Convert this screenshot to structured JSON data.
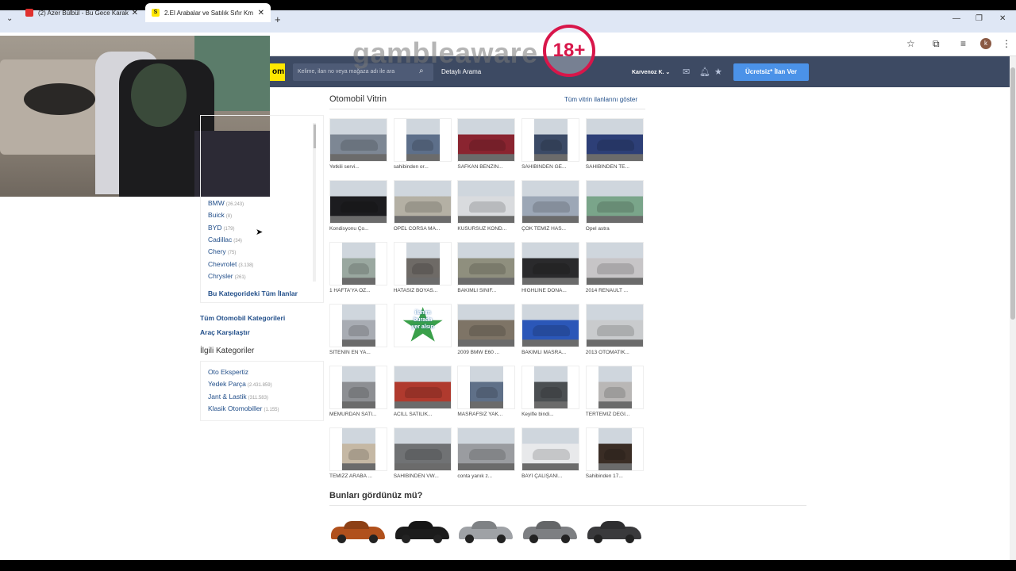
{
  "browser": {
    "tabs": [
      {
        "title": "(2) Azer Bülbül - Bu Gece Karak",
        "favicon_color": "#e0312f"
      },
      {
        "title": "2.El Arabalar ve Satılık Sıfır Km",
        "favicon_color": "#ffe800"
      }
    ],
    "new_tab": "+",
    "avatar_letter": "k"
  },
  "overlay": {
    "gamble_text": "gambleaware",
    "age_badge": "18+"
  },
  "header": {
    "logo": "om",
    "search_placeholder": "Kelime, ilan no veya mağaza adı ile ara",
    "detailed_search": "Detaylı Arama",
    "user": "Karvenoz K.",
    "post_ad": "Ücretsiz* İlan Ver"
  },
  "sidebar": {
    "brands": [
      {
        "name": "BMW",
        "count": "(26.243)"
      },
      {
        "name": "Buick",
        "count": "(8)"
      },
      {
        "name": "BYD",
        "count": "(179)"
      },
      {
        "name": "Cadillac",
        "count": "(34)"
      },
      {
        "name": "Chery",
        "count": "(75)"
      },
      {
        "name": "Chevrolet",
        "count": "(3.138)"
      },
      {
        "name": "Chrysler",
        "count": "(261)"
      }
    ],
    "all_ads": "Bu Kategorideki Tüm İlanlar",
    "links": [
      "Tüm Otomobil Kategorileri",
      "Araç Karşılaştır"
    ],
    "related_title": "İlgili Kategoriler",
    "related": [
      {
        "name": "Oto Ekspertiz",
        "count": ""
      },
      {
        "name": "Yedek Parça",
        "count": "(2.431.859)"
      },
      {
        "name": "Jant & Lastik",
        "count": "(311.583)"
      },
      {
        "name": "Klasik Otomobiller",
        "count": "(1.155)"
      }
    ]
  },
  "vitrin": {
    "title": "Otomobil Vitrin",
    "show_all": "Tüm vitrin ilanlarını göster",
    "items": [
      {
        "caption": "Yetkili servi...",
        "color": "#7d8794"
      },
      {
        "caption": "sahibinden or...",
        "color": "#5d6f8a"
      },
      {
        "caption": "SAFKAN BENZİN...",
        "color": "#8a2430"
      },
      {
        "caption": "SAHİBİNDEN GE...",
        "color": "#3b4a66"
      },
      {
        "caption": "SAHİBİNDEN TE...",
        "color": "#2d3f77"
      },
      {
        "caption": "Kondisyonu Ço...",
        "color": "#1c1c1f"
      },
      {
        "caption": "OPEL CORSA MA...",
        "color": "#b4b0a4"
      },
      {
        "caption": "KUSURSUZ KOND...",
        "color": "#d9dbde"
      },
      {
        "caption": "ÇOK TEMİZ HAS...",
        "color": "#9ca7b6"
      },
      {
        "caption": "Opel astra",
        "color": "#7aa58a"
      },
      {
        "caption": "1 HAFTA'YA ÖZ...",
        "color": "#9aa8a0"
      },
      {
        "caption": "HATASIZ BOYAS...",
        "color": "#6e6a66"
      },
      {
        "caption": "BAKIMLI SINIF...",
        "color": "#8f8f7e"
      },
      {
        "caption": "HİGHLİNE DONA...",
        "color": "#2a2a2c"
      },
      {
        "caption": "2014 RENAULT ...",
        "color": "#c7c5c7"
      },
      {
        "caption": "SİTENİN EN YA...",
        "color": "#a8acb3"
      },
      {
        "caption": "",
        "color": "#3aa04a"
      },
      {
        "caption": "2009 BMW E60 ...",
        "color": "#7e7466"
      },
      {
        "caption": "BAKIMLI MASRA...",
        "color": "#2b57b8"
      },
      {
        "caption": "2013 OTOMATİK...",
        "color": "#c9cbcd"
      },
      {
        "caption": "MEMURDAN SATI...",
        "color": "#8d8f93"
      },
      {
        "caption": "ACİLL SATILIK...",
        "color": "#b03a2e"
      },
      {
        "caption": "MASRAFSIZ YAK...",
        "color": "#5f7088"
      },
      {
        "caption": "Keyifle bindi...",
        "color": "#4b4f52"
      },
      {
        "caption": "TERTEMİZ DEĞİ...",
        "color": "#b9b7b6"
      },
      {
        "caption": "TEMİZZ ARABA ...",
        "color": "#c5b8a4"
      },
      {
        "caption": "SAHİBİNDEN VW...",
        "color": "#707274"
      },
      {
        "caption": "conta yanık z...",
        "color": "#9a9ca0"
      },
      {
        "caption": "BAYİ ÇALIŞANI...",
        "color": "#e8e9eb"
      },
      {
        "caption": "Sahibinden 17...",
        "color": "#3a2d25"
      }
    ],
    "placeholder_ad": {
      "line1": "ilanım",
      "line2": "burada",
      "line3": "yer alsın"
    }
  },
  "seen": {
    "title": "Bunları gördünüz mü?",
    "cars": [
      {
        "color": "#b0501c"
      },
      {
        "color": "#1c1c1c"
      },
      {
        "color": "#9fa2a6"
      },
      {
        "color": "#7d7f82"
      },
      {
        "color": "#3a3a3c"
      }
    ]
  }
}
